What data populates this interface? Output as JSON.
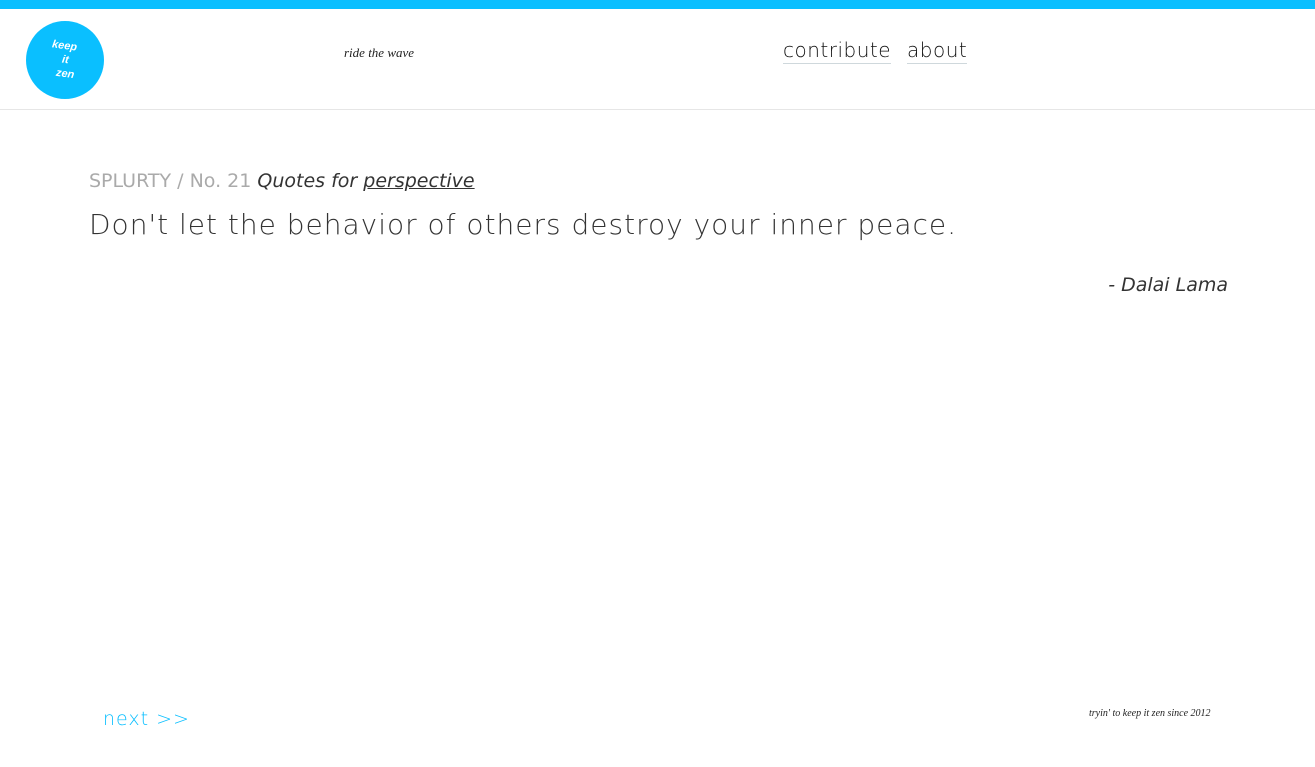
{
  "colors": {
    "accent": "#0abfff",
    "text": "#333333",
    "muted": "#aaaaaa"
  },
  "logo": {
    "lines": [
      "keep",
      "it",
      "zen"
    ]
  },
  "header": {
    "tagline": "ride the wave",
    "nav": [
      {
        "label": "contribute"
      },
      {
        "label": "about"
      }
    ]
  },
  "breadcrumb": {
    "site": "SPLURTY",
    "separator": " / ",
    "number": "No. 21",
    "quotes_for": "Quotes for",
    "category": "perspective"
  },
  "quote": {
    "text": "Don't let the behavior of others destroy your inner peace.",
    "author": "- Dalai Lama"
  },
  "footer": {
    "next_label": "next >>",
    "note": "tryin' to keep it zen since 2012"
  }
}
